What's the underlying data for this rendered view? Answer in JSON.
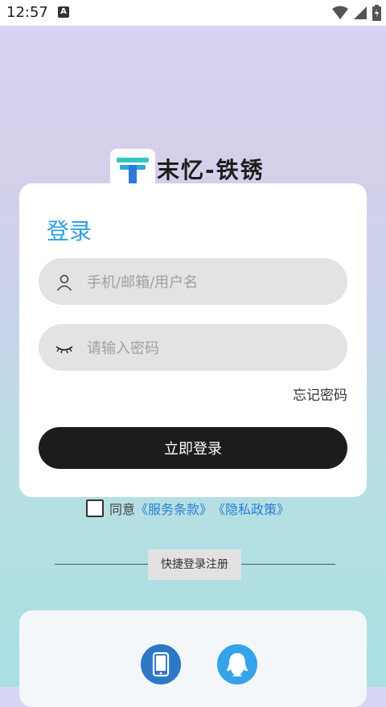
{
  "status_bar": {
    "time": "12:57",
    "notif_letter": "A"
  },
  "brand": {
    "name": "末忆-铁锈"
  },
  "login": {
    "title": "登录",
    "username_placeholder": "手机/邮箱/用户名",
    "password_placeholder": "请输入密码",
    "forgot_label": "忘记密码",
    "submit_label": "立即登录"
  },
  "agreement": {
    "prefix": "同意",
    "terms_label": "《服务条款》",
    "privacy_label": "《隐私政策》"
  },
  "quick": {
    "label": "快捷登录注册"
  },
  "social": [
    {
      "icon": "phone-icon"
    },
    {
      "icon": "qq-icon"
    }
  ],
  "colors": {
    "accent": "#2ea1e0",
    "button": "#1c1c1c",
    "phone": "#2d77c6",
    "qq": "#34a3ea"
  }
}
